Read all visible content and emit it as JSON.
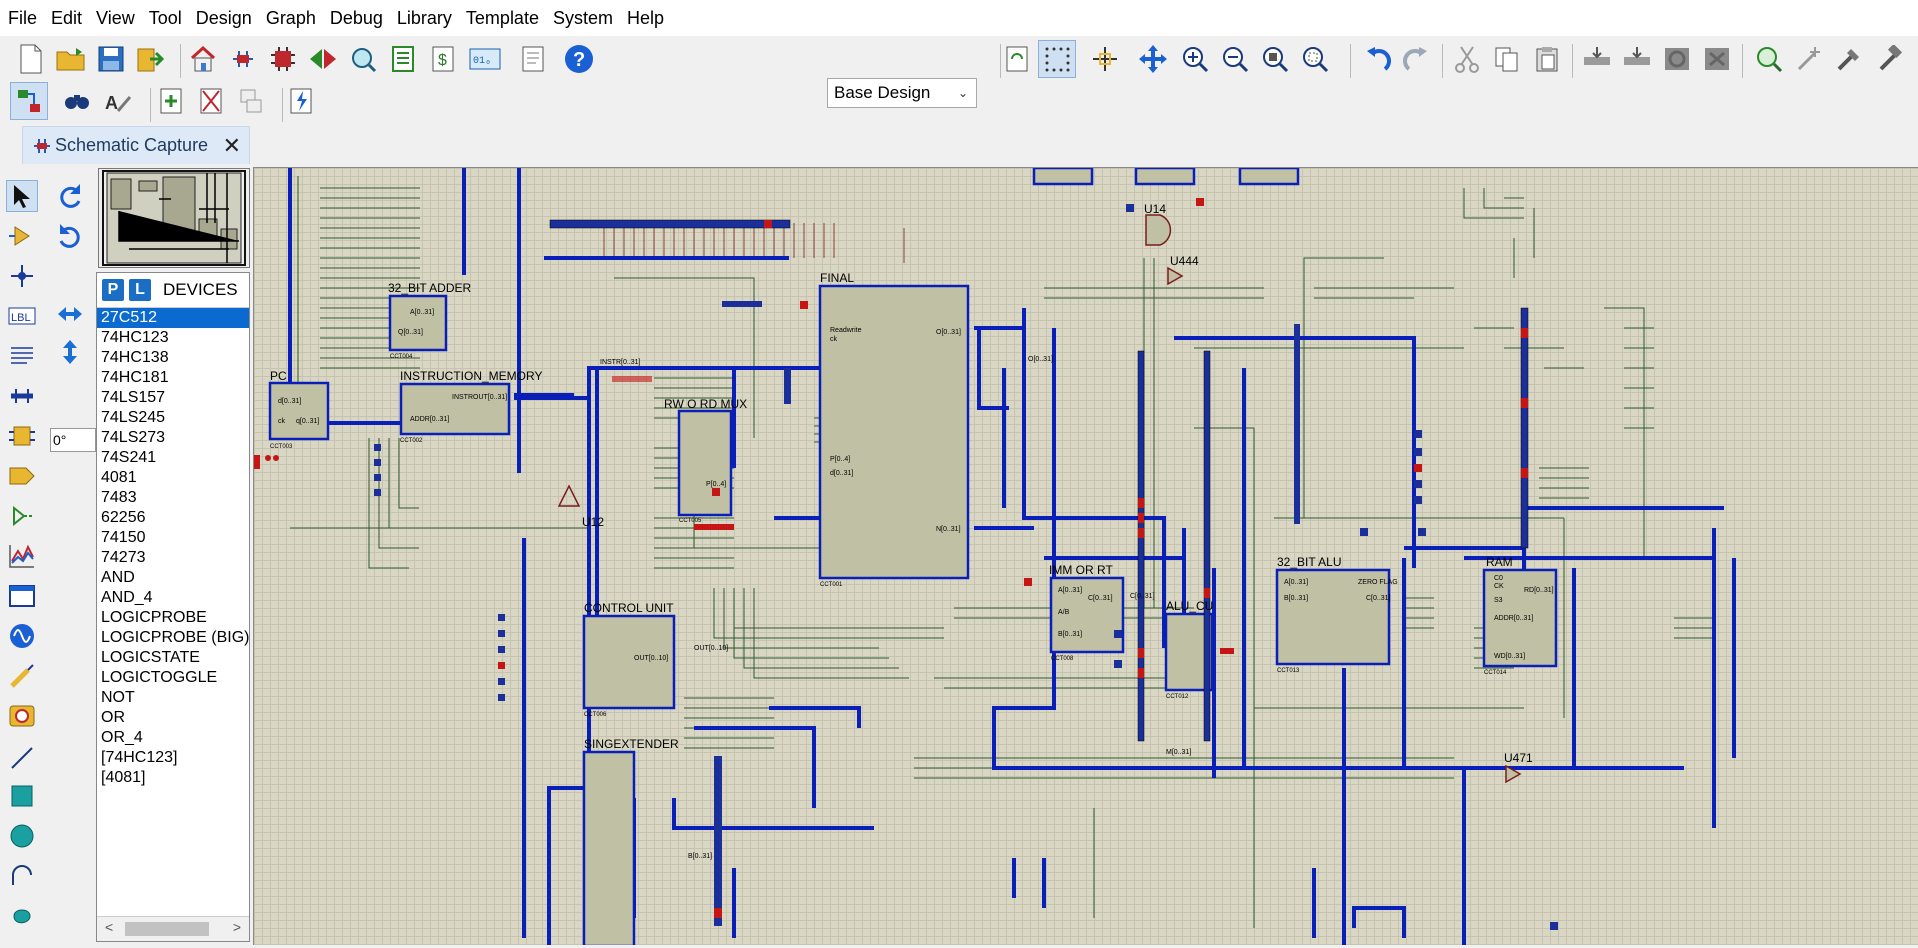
{
  "menu": [
    "File",
    "Edit",
    "View",
    "Tool",
    "Design",
    "Graph",
    "Debug",
    "Library",
    "Template",
    "System",
    "Help"
  ],
  "toolbar": {
    "design_select": "Base Design"
  },
  "tab": {
    "label": "Schematic Capture",
    "close": "✕"
  },
  "angle_value": "0°",
  "devices": {
    "header": "DEVICES",
    "p_label": "P",
    "l_label": "L",
    "items": [
      "27C512",
      "74HC123",
      "74HC138",
      "74HC181",
      "74LS157",
      "74LS245",
      "74LS273",
      "74S241",
      "4081",
      "7483",
      "62256",
      "74150",
      "74273",
      "AND",
      "AND_4",
      "LOGICPROBE",
      "LOGICPROBE (BIG)",
      "LOGICSTATE",
      "LOGICTOGGLE",
      "NOT",
      "OR",
      "OR_4",
      "[74HC123]",
      "[4081]"
    ],
    "selected": "27C512"
  },
  "schematic": {
    "blocks": {
      "pc": "PC",
      "adder": "32_BIT ADDER",
      "imem": "INSTRUCTION_MEMORY",
      "final": "FINAL",
      "rw_mux": "RW O RD MUX",
      "control": "CONTROL UNIT",
      "sign": "SINGEXTENDER",
      "imm": "IMM OR RT",
      "alu_cu": "ALU_CU",
      "alu": "32_BIT ALU",
      "ram": "RAM",
      "u14": "U14",
      "u444": "U444",
      "u12": "U12",
      "u471": "U471"
    },
    "pins": {
      "pc_d": "d[0..31]",
      "pc_ck": "ck",
      "pc_q": "q[0..31]",
      "adder_a": "A[0..31]",
      "adder_q": "Q[0..31]",
      "imem_addr": "ADDR[0..31]",
      "imem_out": "INSTROUT[0..31]",
      "final_o": "O[0..31]",
      "final_n": "N[0..31]",
      "final_p": "P[0..4]",
      "final_d": "d[0..31]",
      "final_rw": "Readwrite",
      "final_ck": "ck",
      "imm_a": "A[0..31]",
      "imm_ab": "A/B",
      "imm_b": "B[0..31]",
      "imm_c": "C[0..31]",
      "alu_a": "A[0..31]",
      "alu_b": "B[0..31]",
      "alu_c": "C[0..31]",
      "alu_zero": "ZERO FLAG",
      "ram_co": "C0",
      "ram_ck": "CK",
      "ram_s3": "S3",
      "ram_addr": "ADDR[0..31]",
      "ram_wd": "WD[0..31]",
      "ram_rd": "RD[0..31]",
      "cu_out": "OUT[0..10]",
      "mux_p": "P[0..4]"
    },
    "ids": {
      "pc": "CCT003",
      "adder": "CCT004",
      "imem": "CCT002",
      "final": "CCT001",
      "rw_mux": "CCT005",
      "control": "CCT006",
      "imm": "CCT008",
      "alu_cu": "CCT012",
      "alu": "CCT013",
      "ram": "CCT014"
    },
    "net_labels": {
      "instr": "INSTR[0..31]",
      "o_bus": "O[0..31]",
      "m_bus": "M[0..31]",
      "b_bus": "B[0..31]",
      "c_bus": "C[0..31]",
      "out_bus": "OUT[0..10]"
    }
  }
}
